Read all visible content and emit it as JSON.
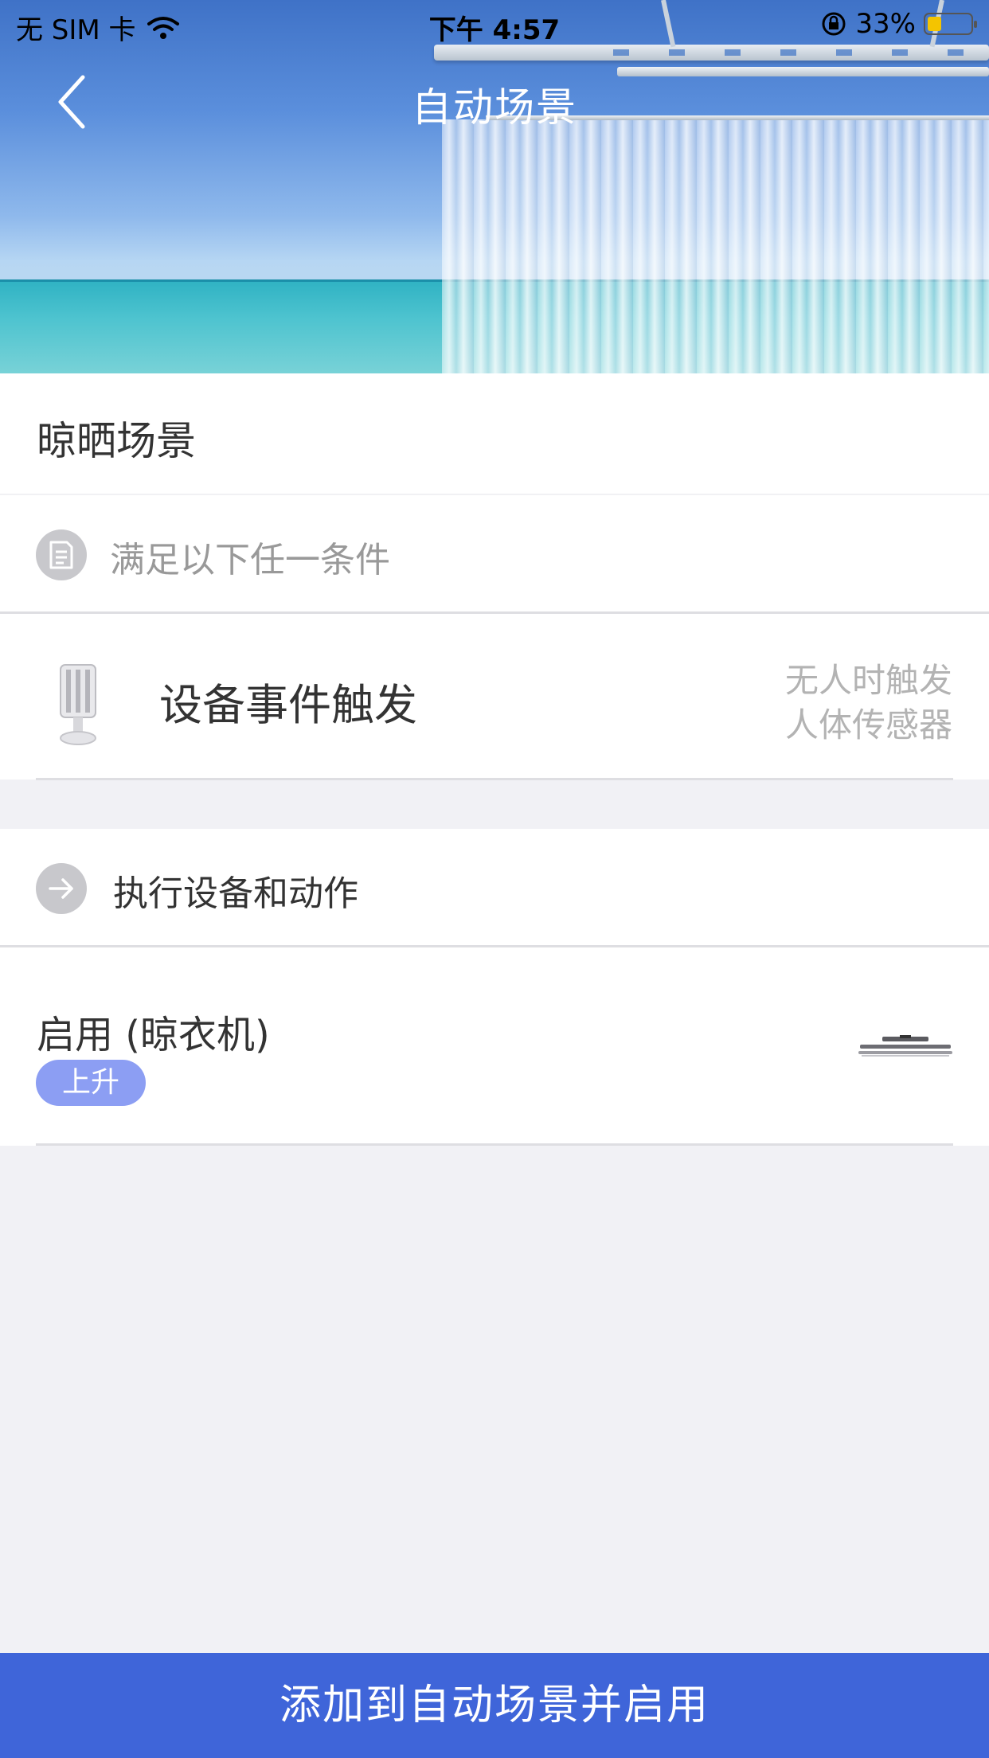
{
  "status_bar": {
    "carrier": "无 SIM 卡",
    "time": "下午 4:57",
    "battery": "33%",
    "battery_level": 0.33,
    "battery_color": "#f4c400"
  },
  "nav": {
    "title": "自动场景",
    "back_icon": "chevron-left-icon"
  },
  "scene": {
    "name": "晾晒场景"
  },
  "conditions": {
    "header": "满足以下任一条件",
    "header_icon": "document-icon",
    "items": [
      {
        "title": "设备事件触发",
        "event": "无人时触发",
        "device": "人体传感器",
        "device_icon": "motion-sensor-icon"
      }
    ]
  },
  "actions": {
    "header": "执行设备和动作",
    "header_icon": "arrow-right-icon",
    "items": [
      {
        "title": "启用 (晾衣机)",
        "badge": "上升",
        "badge_color": "#8c9ef3",
        "device_icon": "clothes-dryer-icon"
      }
    ]
  },
  "bottom_button": {
    "label": "添加到自动场景并启用",
    "color": "#3f65d9"
  }
}
